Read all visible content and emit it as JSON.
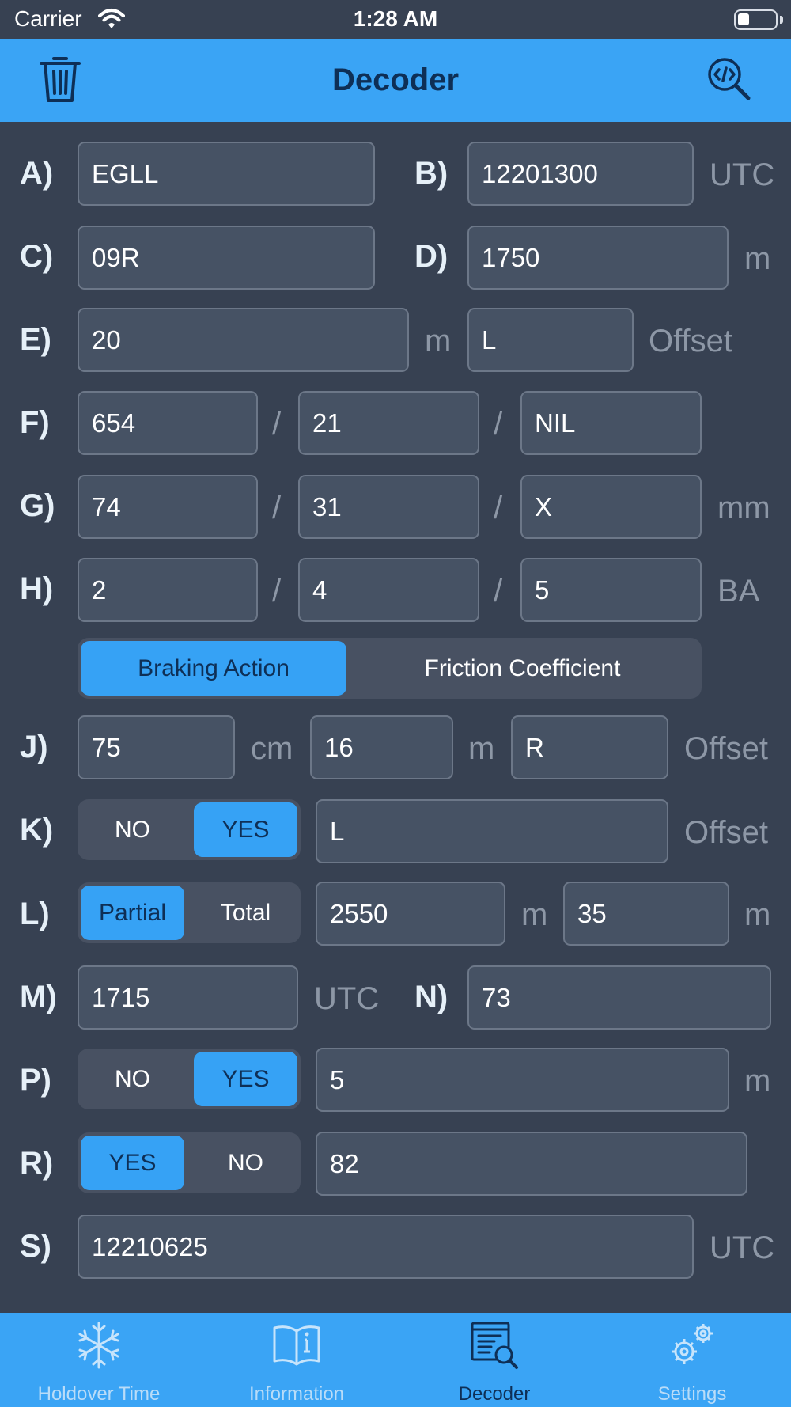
{
  "status_bar": {
    "carrier": "Carrier",
    "time": "1:28 AM"
  },
  "nav": {
    "title": "Decoder",
    "left_icon": "trash-icon",
    "right_icon": "code-search-icon"
  },
  "rows": {
    "A": {
      "label": "A)",
      "value": "EGLL"
    },
    "B": {
      "label": "B)",
      "value": "12201300",
      "unit": "UTC"
    },
    "C": {
      "label": "C)",
      "value": "09R"
    },
    "D": {
      "label": "D)",
      "value": "1750",
      "unit": "m"
    },
    "E": {
      "label": "E)",
      "value": "20",
      "unit": "m",
      "offset_value": "L",
      "offset_label": "Offset"
    },
    "F": {
      "label": "F)",
      "values": [
        "654",
        "21",
        "NIL"
      ],
      "sep": "/"
    },
    "G": {
      "label": "G)",
      "values": [
        "74",
        "31",
        "X"
      ],
      "sep": "/",
      "unit": "mm"
    },
    "H": {
      "label": "H)",
      "values": [
        "2",
        "4",
        "5"
      ],
      "sep": "/",
      "unit": "BA"
    },
    "H_mode": {
      "options": [
        "Braking Action",
        "Friction Coefficient"
      ],
      "selected": "Braking Action"
    },
    "J": {
      "label": "J)",
      "depth": "75",
      "depth_unit": "cm",
      "width": "16",
      "width_unit": "m",
      "offset_value": "R",
      "offset_label": "Offset"
    },
    "K": {
      "label": "K)",
      "options": [
        "NO",
        "YES"
      ],
      "selected": "YES",
      "value": "L",
      "offset_label": "Offset"
    },
    "L": {
      "label": "L)",
      "options": [
        "Partial",
        "Total"
      ],
      "selected": "Partial",
      "length": "2550",
      "length_unit": "m",
      "width": "35",
      "width_unit": "m"
    },
    "M": {
      "label": "M)",
      "value": "1715",
      "unit": "UTC"
    },
    "N": {
      "label": "N)",
      "value": "73"
    },
    "P": {
      "label": "P)",
      "options": [
        "NO",
        "YES"
      ],
      "selected": "YES",
      "value": "5",
      "unit": "m"
    },
    "R": {
      "label": "R)",
      "options": [
        "YES",
        "NO"
      ],
      "selected": "YES",
      "value": "82"
    },
    "S": {
      "label": "S)",
      "value": "12210625",
      "unit": "UTC"
    }
  },
  "tabs": [
    {
      "label": "Holdover Time",
      "icon": "snowflake-icon",
      "active": false
    },
    {
      "label": "Information",
      "icon": "book-icon",
      "active": false
    },
    {
      "label": "Decoder",
      "icon": "document-search-icon",
      "active": true
    },
    {
      "label": "Settings",
      "icon": "gears-icon",
      "active": false
    }
  ],
  "colors": {
    "background": "#374152",
    "accent": "#3aa4f5",
    "field": "#465264",
    "title": "#0e2f56"
  }
}
